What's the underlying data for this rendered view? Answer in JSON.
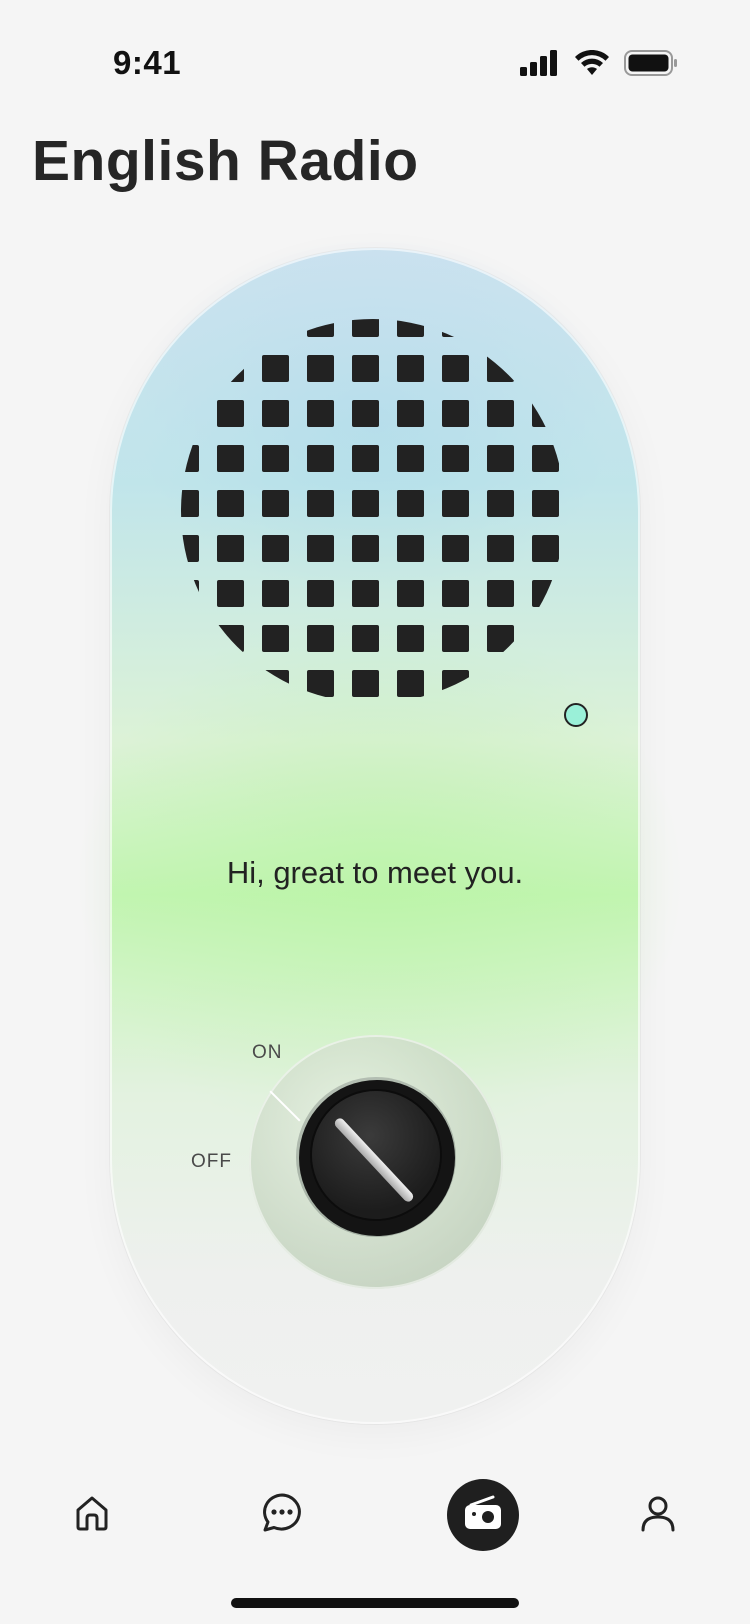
{
  "status_bar": {
    "time": "9:41",
    "icons": [
      "cellular-signal-icon",
      "wifi-icon",
      "battery-icon"
    ]
  },
  "header": {
    "title": "English Radio"
  },
  "radio": {
    "message": "Hi, great to meet you.",
    "knob": {
      "on_label": "ON",
      "off_label": "OFF",
      "state": "on"
    },
    "indicator_color": "#9af0d8"
  },
  "tab_bar": {
    "items": [
      {
        "icon": "home-icon",
        "active": false
      },
      {
        "icon": "chat-bubble-icon",
        "active": false
      },
      {
        "icon": "radio-icon",
        "active": true
      },
      {
        "icon": "user-profile-icon",
        "active": false
      }
    ]
  },
  "colors": {
    "background": "#f5f5f5",
    "dark": "#1f1f1f",
    "accent_green": "#b6f39c",
    "accent_blue": "#a9dcec"
  }
}
